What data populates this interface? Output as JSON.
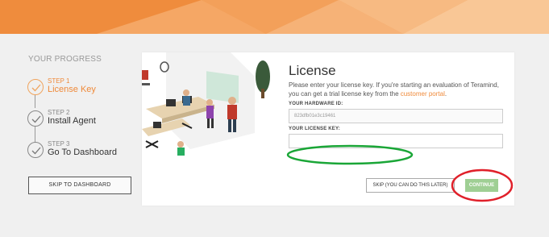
{
  "sidebar": {
    "progress_title": "YOUR PROGRESS",
    "steps": [
      {
        "num": "STEP 1",
        "name": "License Key",
        "active": true
      },
      {
        "num": "STEP 2",
        "name": "Install Agent",
        "active": false
      },
      {
        "num": "STEP 3",
        "name": "Go To Dashboard",
        "active": false
      }
    ],
    "skip_button": "SKIP TO DASHBOARD"
  },
  "license": {
    "title": "License",
    "description_1": "Please enter your license key. If you're starting an evaluation of Teramind, you can get a trial license key from the ",
    "description_link": "customer portal",
    "description_2": ".",
    "hardware_label": "YOUR HARDWARE ID:",
    "hardware_value": "823dfb01e3c19461",
    "key_label": "YOUR LICENSE KEY:",
    "key_value": ""
  },
  "actions": {
    "skip_label": "SKIP (YOU CAN DO THIS LATER)",
    "continue_label": "CONTINUE"
  },
  "colors": {
    "accent": "#ef8a3a",
    "continue_bg": "#9fcf94",
    "annotation_green": "#1aa637",
    "annotation_red": "#e0202a"
  }
}
